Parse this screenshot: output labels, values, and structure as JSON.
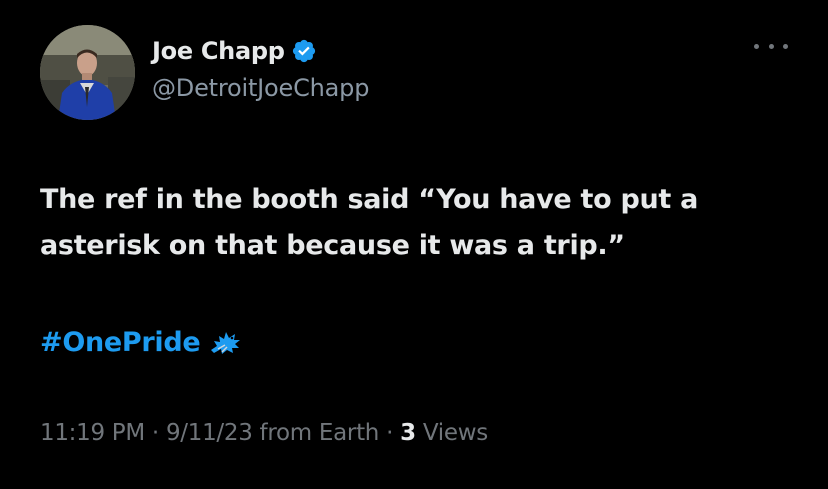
{
  "author": {
    "display_name": "Joe Chapp",
    "handle": "@DetroitJoeChapp",
    "verified_icon": "verified-badge-icon",
    "avatar": "profile-photo"
  },
  "tweet": {
    "text_line_1": "The ref in the booth said “You have to put a",
    "text_line_2": "asterisk on that because it was a trip.”",
    "hashtag": "#OnePride",
    "hashtag_emoji": "detroit-lions-icon"
  },
  "meta": {
    "time": "11:19 PM",
    "separator_1": " · ",
    "date": "9/11/23",
    "source": " from Earth",
    "separator_2": " · ",
    "views_count": "3",
    "views_label": " Views"
  },
  "colors": {
    "background": "#000000",
    "primary_text": "#e7e9ea",
    "secondary_text": "#71767b",
    "accent": "#1d9bf0"
  },
  "icons": {
    "more": "more-options-icon"
  }
}
